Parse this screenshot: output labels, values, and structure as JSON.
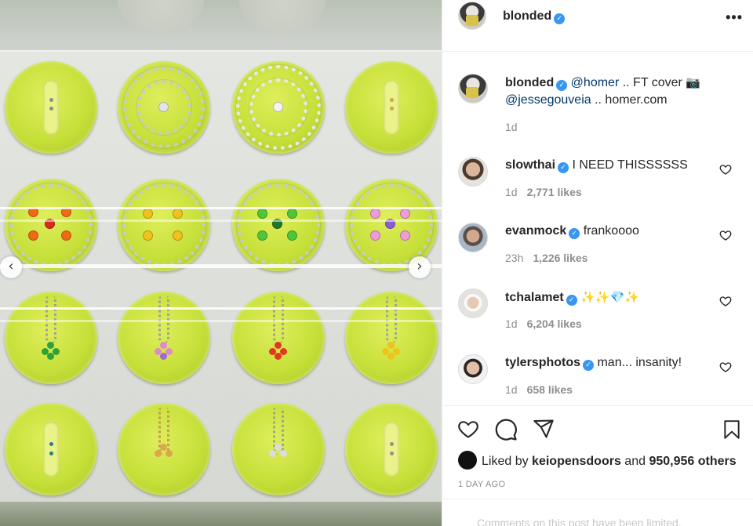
{
  "post": {
    "author": "blonded",
    "verified_glyph": "✓",
    "more_glyph": "•••",
    "caption": {
      "username": "blonded",
      "mention1": "@homer",
      "text1": " .. FT cover ",
      "camera_icon": "📷",
      "mention2": "@jessegouveia",
      "text2": " .. homer.com",
      "time": "1d"
    },
    "comments": [
      {
        "username": "slowthai",
        "text": "I NEED THISSSSSS",
        "time": "1d",
        "likes": "2,771 likes"
      },
      {
        "username": "evanmock",
        "text": "frankoooo",
        "time": "23h",
        "likes": "1,226 likes"
      },
      {
        "username": "tchalamet",
        "text": "",
        "emoji": [
          "sparkles",
          "sparkles",
          "gem-stone",
          "sparkles"
        ],
        "time": "1d",
        "likes": "6,204 likes"
      },
      {
        "username": "tylersphotos",
        "text": "man... insanity!",
        "time": "1d",
        "likes": "658 likes"
      }
    ],
    "liked_by": {
      "prefix": "Liked by ",
      "user": "keiopensdoors",
      "middle": " and ",
      "count": "950,956 others"
    },
    "date": "1 DAY AGO",
    "comments_limited": "Comments on this post have been limited."
  },
  "carousel": {
    "prev_glyph": "‹",
    "next_glyph": "›"
  },
  "colors": {
    "verified": "#3897f0",
    "link": "#00376b",
    "muted": "#8e8e8e",
    "disc": "#c7e03a"
  },
  "icons": [
    "heart-icon",
    "comment-icon",
    "share-icon",
    "bookmark-icon",
    "more-icon",
    "camera-icon"
  ]
}
